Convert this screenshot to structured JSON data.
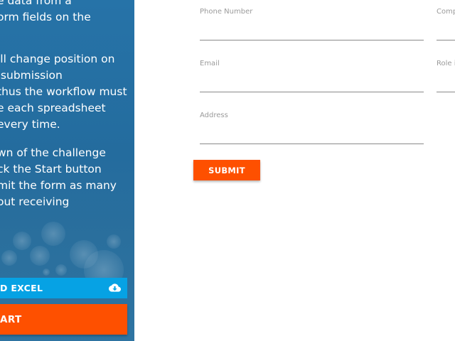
{
  "instructions": {
    "para1": "e data from a\norm fields on the",
    "para2": "ill change position on\n submission\nthus the workflow must\ne each spreadsheet\nevery time.",
    "para3": "wn of the challenge\nck the Start button\nmit the form as many\nout receiving"
  },
  "buttons": {
    "excel_label": "D EXCEL",
    "start_label": "ART",
    "submit_label": "SUBMIT"
  },
  "form": {
    "phone_label": "Phone Number",
    "company_label": "Comp",
    "email_label": "Email",
    "role_label": "Role i",
    "address_label": "Address",
    "phone_value": "",
    "company_value": "",
    "email_value": "",
    "role_value": "",
    "address_value": ""
  },
  "colors": {
    "panel_blue": "#2673a8",
    "excel_blue": "#06a2e4",
    "accent_orange": "#fe5000"
  }
}
